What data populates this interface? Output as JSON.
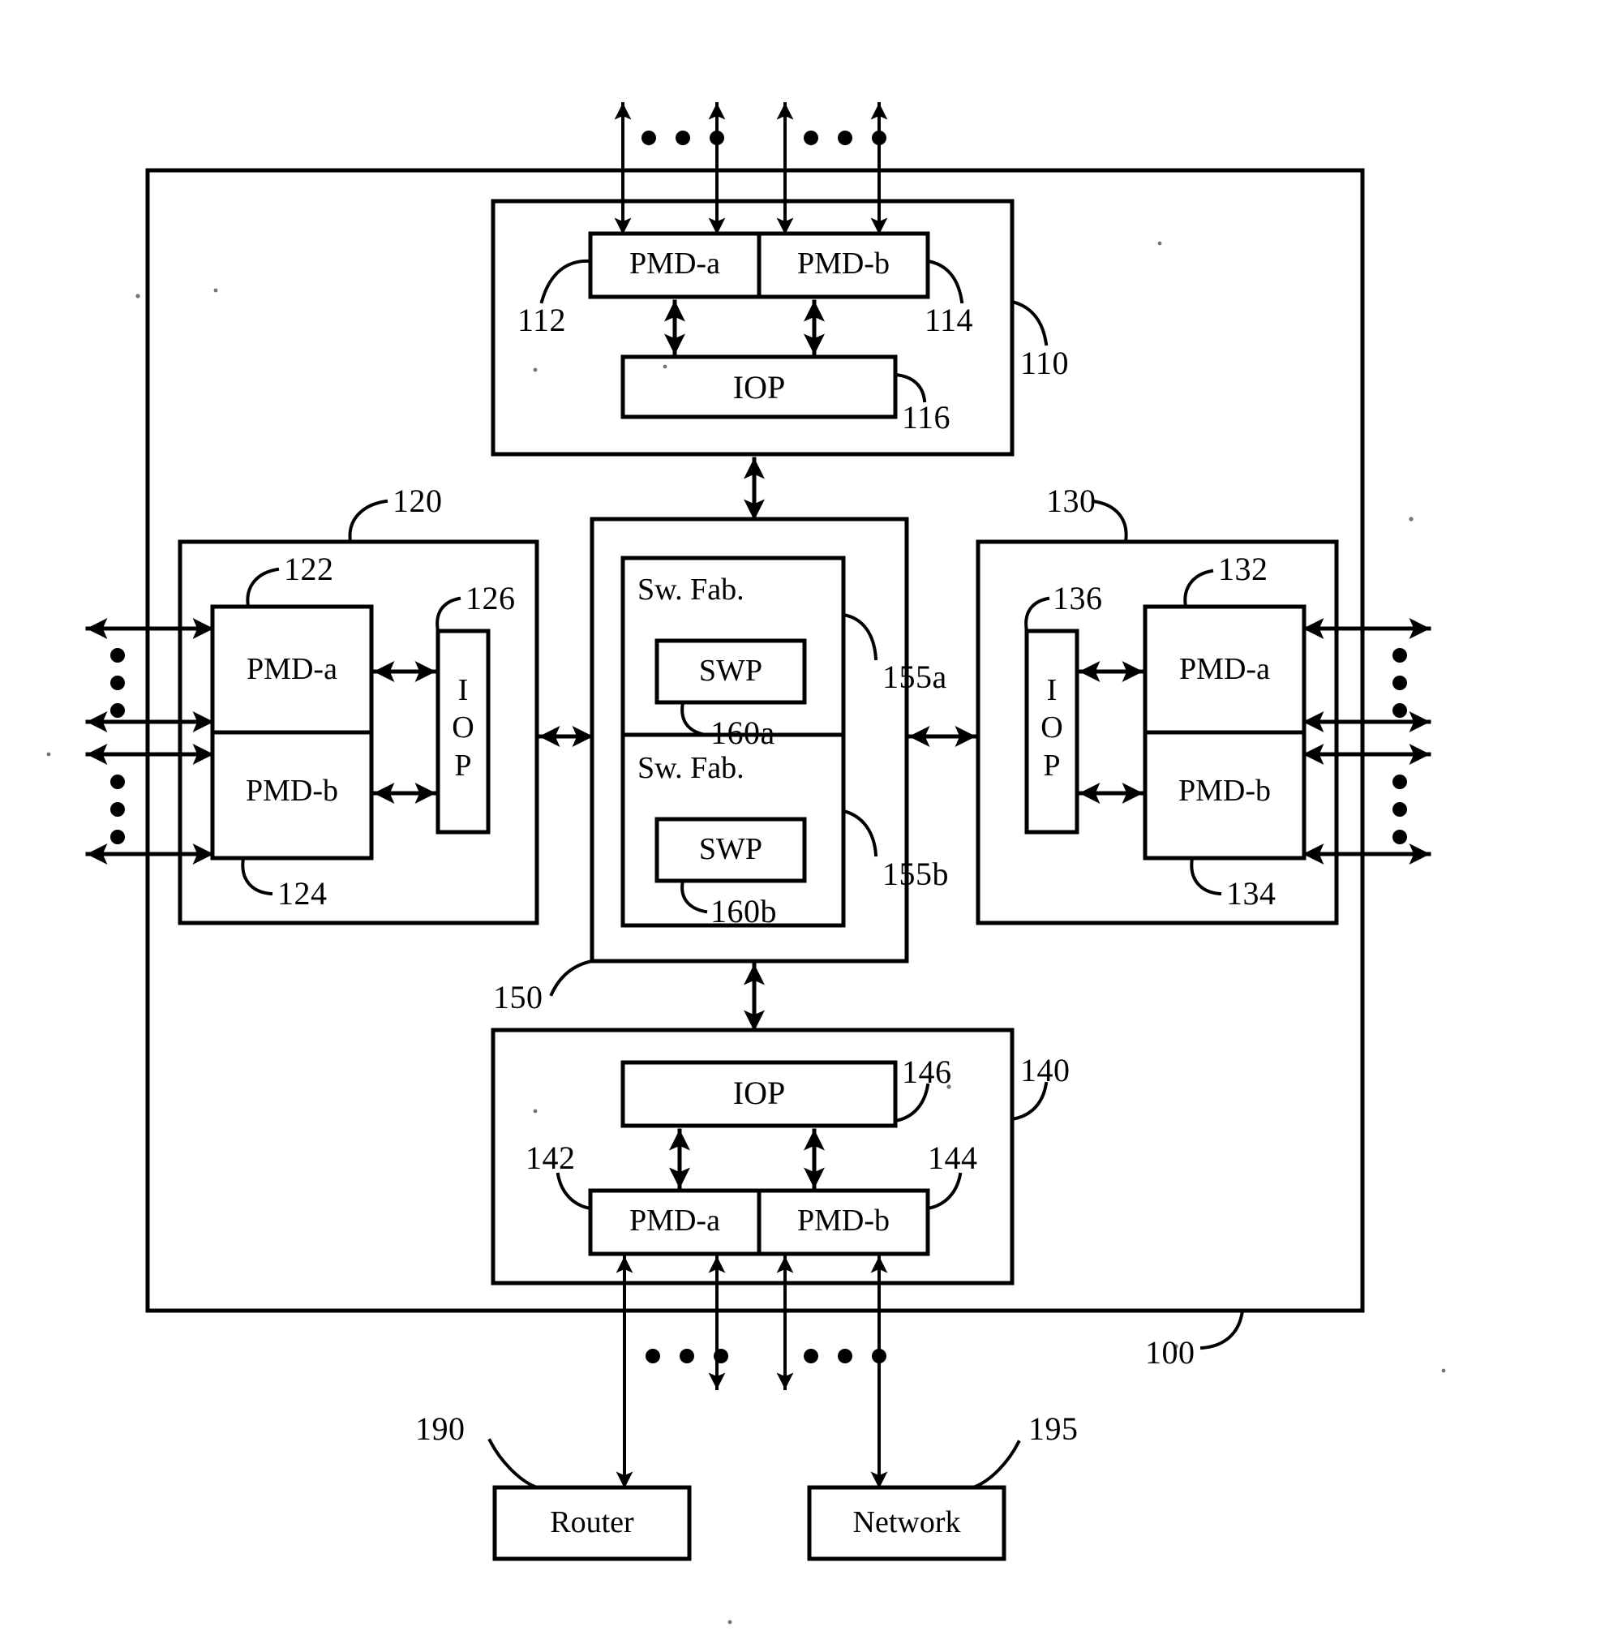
{
  "figure": {
    "title": "Network switching system block diagram",
    "type": "patent-block-diagram",
    "stroke_color": "#000000",
    "background_color": "#ffffff"
  },
  "system": {
    "ref": "100",
    "label": "100"
  },
  "modules": {
    "top": {
      "ref": "110",
      "pmd_a": "PMD-a",
      "pmd_a_ref": "112",
      "pmd_b": "PMD-b",
      "pmd_b_ref": "114",
      "iop": "IOP",
      "iop_ref": "116"
    },
    "left": {
      "ref": "120",
      "pmd_a": "PMD-a",
      "pmd_a_ref": "122",
      "pmd_b": "PMD-b",
      "pmd_b_ref": "124",
      "iop_line1": "I",
      "iop_line2": "O",
      "iop_line3": "P",
      "iop_ref": "126"
    },
    "right": {
      "ref": "130",
      "pmd_a": "PMD-a",
      "pmd_a_ref": "132",
      "pmd_b": "PMD-b",
      "pmd_b_ref": "134",
      "iop_line1": "I",
      "iop_line2": "O",
      "iop_line3": "P",
      "iop_ref": "136"
    },
    "bottom": {
      "ref": "140",
      "pmd_a": "PMD-a",
      "pmd_a_ref": "142",
      "pmd_b": "PMD-b",
      "pmd_b_ref": "144",
      "iop": "IOP",
      "iop_ref": "146"
    }
  },
  "switch_fabric": {
    "ref": "150",
    "fabric_a": {
      "label": "Sw. Fab.",
      "ref": "155a",
      "swp": "SWP",
      "swp_ref": "160a"
    },
    "fabric_b": {
      "label": "Sw. Fab.",
      "ref": "155b",
      "swp": "SWP",
      "swp_ref": "160b"
    }
  },
  "external": {
    "router": {
      "label": "Router",
      "ref": "190"
    },
    "network": {
      "label": "Network",
      "ref": "195"
    }
  }
}
